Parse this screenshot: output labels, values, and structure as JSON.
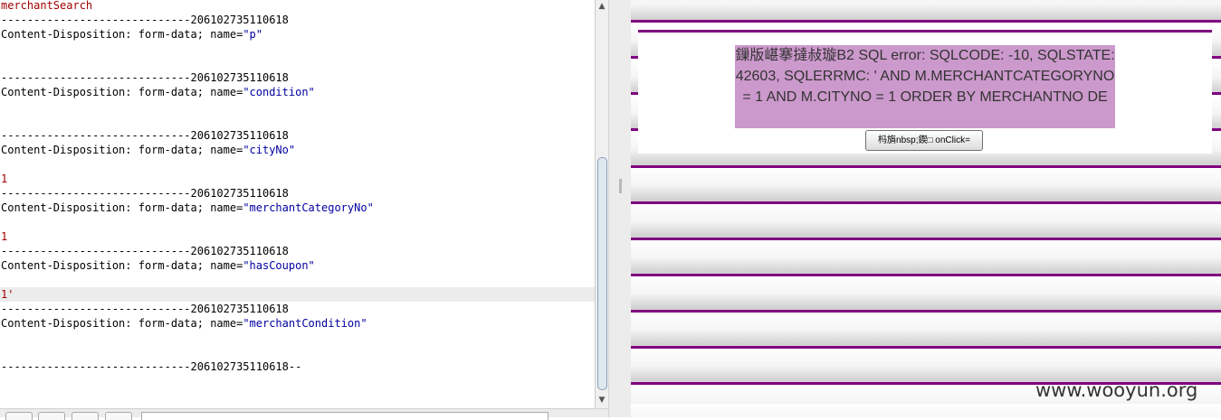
{
  "request": {
    "lines": [
      {
        "key": "merchantSearch",
        "color": "r"
      },
      {
        "key": "-----------------------------206102735110618",
        "color": "k"
      },
      {
        "key": "Content-Disposition: form-data; name=",
        "value": "\"p\"",
        "color": "k"
      },
      {
        "key": "",
        "color": "k"
      },
      {
        "key": "",
        "color": "k"
      },
      {
        "key": "-----------------------------206102735110618",
        "color": "k"
      },
      {
        "key": "Content-Disposition: form-data; name=",
        "value": "\"condition\"",
        "color": "k"
      },
      {
        "key": "",
        "color": "k"
      },
      {
        "key": "",
        "color": "k"
      },
      {
        "key": "-----------------------------206102735110618",
        "color": "k"
      },
      {
        "key": "Content-Disposition: form-data; name=",
        "value": "\"cityNo\"",
        "color": "k"
      },
      {
        "key": "",
        "color": "k"
      },
      {
        "key": "1",
        "color": "r"
      },
      {
        "key": "-----------------------------206102735110618",
        "color": "k"
      },
      {
        "key": "Content-Disposition: form-data; name=",
        "value": "\"merchantCategoryNo\"",
        "color": "k"
      },
      {
        "key": "",
        "color": "k"
      },
      {
        "key": "1",
        "color": "r"
      },
      {
        "key": "-----------------------------206102735110618",
        "color": "k"
      },
      {
        "key": "Content-Disposition: form-data; name=",
        "value": "\"hasCoupon\"",
        "color": "k"
      },
      {
        "key": "",
        "color": "k"
      },
      {
        "key": "1'",
        "color": "r",
        "highlight": true
      },
      {
        "key": "-----------------------------206102735110618",
        "color": "k"
      },
      {
        "key": "Content-Disposition: form-data; name=",
        "value": "\"merchantCondition\"",
        "color": "k"
      },
      {
        "key": "",
        "color": "k"
      },
      {
        "key": "",
        "color": "k"
      },
      {
        "key": "-----------------------------206102735110618--",
        "color": "k"
      }
    ]
  },
  "scrollbar": {
    "up_arrow": "▲",
    "down_arrow": "▼"
  },
  "response": {
    "error_text": "鏁版嵁搴撻敊璇B2 SQL error: SQLCODE: -10, SQLSTATE: 42603, SQLERRMC: ' AND M.MERCHANTCATEGORYNO = 1 AND M.CITYNO = 1 ORDER BY MERCHANTNO DE",
    "button_label": "杩旓nbsp;鍥□ onClick=",
    "watermark": "www.wooyun.org",
    "colors": {
      "rule": "#800080",
      "error_bg": "#cc99cc"
    }
  }
}
